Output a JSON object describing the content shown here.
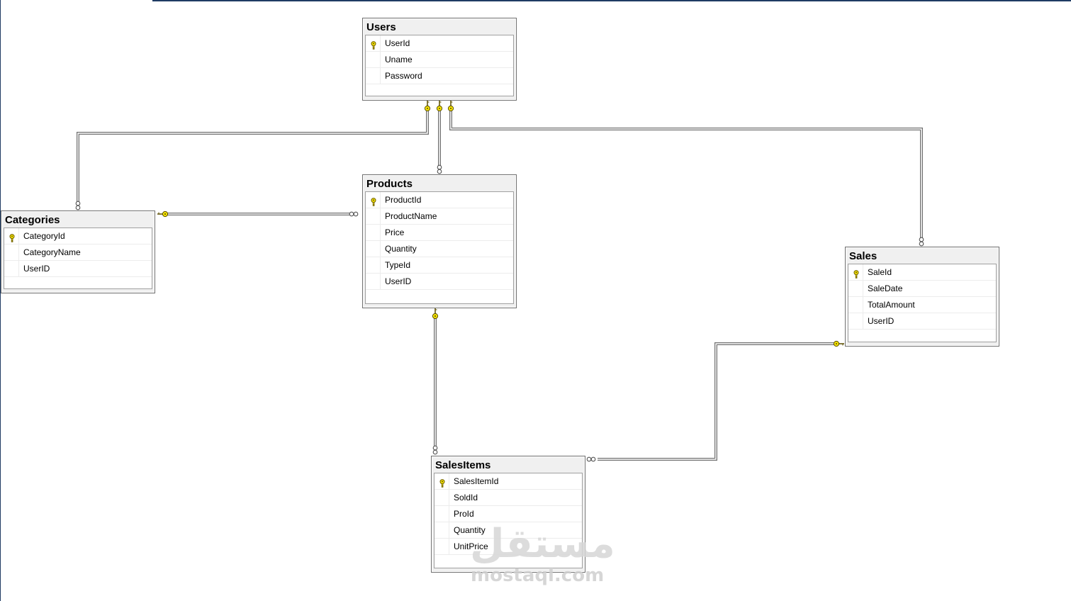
{
  "tables": {
    "users": {
      "title": "Users",
      "columns": [
        {
          "name": "UserId",
          "primary_key": true
        },
        {
          "name": "Uname",
          "primary_key": false
        },
        {
          "name": "Password",
          "primary_key": false
        }
      ]
    },
    "products": {
      "title": "Products",
      "columns": [
        {
          "name": "ProductId",
          "primary_key": true
        },
        {
          "name": "ProductName",
          "primary_key": false
        },
        {
          "name": "Price",
          "primary_key": false
        },
        {
          "name": "Quantity",
          "primary_key": false
        },
        {
          "name": "TypeId",
          "primary_key": false
        },
        {
          "name": "UserID",
          "primary_key": false
        }
      ]
    },
    "categories": {
      "title": "Categories",
      "columns": [
        {
          "name": "CategoryId",
          "primary_key": true
        },
        {
          "name": "CategoryName",
          "primary_key": false
        },
        {
          "name": "UserID",
          "primary_key": false
        }
      ]
    },
    "sales": {
      "title": "Sales",
      "columns": [
        {
          "name": "SaleId",
          "primary_key": true
        },
        {
          "name": "SaleDate",
          "primary_key": false
        },
        {
          "name": "TotalAmount",
          "primary_key": false
        },
        {
          "name": "UserID",
          "primary_key": false
        }
      ]
    },
    "salesitems": {
      "title": "SalesItems",
      "columns": [
        {
          "name": "SalesItemId",
          "primary_key": true
        },
        {
          "name": "SoldId",
          "primary_key": false
        },
        {
          "name": "ProId",
          "primary_key": false
        },
        {
          "name": "Quantity",
          "primary_key": false
        },
        {
          "name": "UnitPrice",
          "primary_key": false
        }
      ]
    }
  },
  "relationships": [
    {
      "from": "users",
      "to": "categories",
      "from_end": "one",
      "to_end": "many"
    },
    {
      "from": "users",
      "to": "products",
      "from_end": "one",
      "to_end": "many"
    },
    {
      "from": "users",
      "to": "sales",
      "from_end": "one",
      "to_end": "many"
    },
    {
      "from": "categories",
      "to": "products",
      "from_end": "one",
      "to_end": "many"
    },
    {
      "from": "products",
      "to": "salesitems",
      "from_end": "one",
      "to_end": "many"
    },
    {
      "from": "sales",
      "to": "salesitems",
      "from_end": "one",
      "to_end": "many"
    }
  ],
  "watermark": {
    "arabic": "مستقل",
    "latin": "mostaql.com"
  },
  "colors": {
    "key_fill": "#f4e300",
    "line": "#707070",
    "frame": "#1f3b63"
  }
}
